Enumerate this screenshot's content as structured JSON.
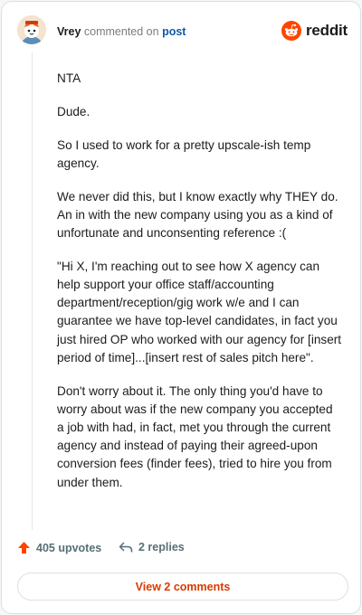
{
  "header": {
    "username": "Vrey",
    "action_text": "commented on",
    "post_link": "post",
    "brand": "reddit"
  },
  "comment": {
    "paragraphs": [
      "NTA",
      "Dude.",
      "So I used to work for a pretty upscale-ish temp agency.",
      "We never did this, but I know exactly why THEY do. An in with the new company using you as a kind of unfortunate and unconsenting reference :(",
      "\"Hi X, I'm reaching out to see how X agency can help support your office staff/accounting department/reception/gig work w/e and I can guarantee we have top-level candidates, in fact you just hired OP who worked with our agency for [insert period of time]...[insert rest of sales pitch here\".",
      "Don't worry about it. The only thing you'd have to worry about was if the new company you accepted a job with had, in fact, met you through the current agency and instead of paying their agreed-upon conversion fees (finder fees), tried to hire you from under them."
    ]
  },
  "actions": {
    "upvotes": "405 upvotes",
    "replies": "2 replies",
    "view_comments": "View 2 comments"
  },
  "colors": {
    "brand": "#ff4500",
    "link": "#0e5aa7",
    "view_button_text": "#d93a00"
  }
}
